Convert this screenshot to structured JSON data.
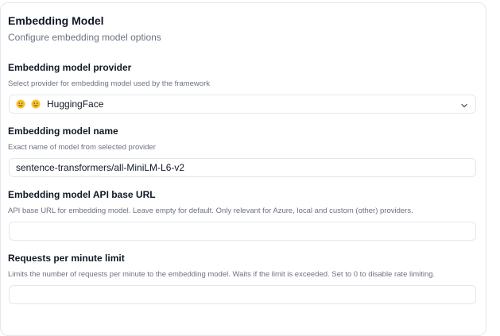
{
  "panel": {
    "title": "Embedding Model",
    "subtitle": "Configure embedding model options"
  },
  "fields": {
    "provider": {
      "label": "Embedding model provider",
      "description": "Select provider for embedding model used by the framework",
      "value": "HuggingFace",
      "icons": [
        "hugging-face-emoji-icon",
        "hugging-face-emoji-icon",
        "chevron-down-icon"
      ]
    },
    "model_name": {
      "label": "Embedding model name",
      "description": "Exact name of model from selected provider",
      "value": "sentence-transformers/all-MiniLM-L6-v2"
    },
    "api_base": {
      "label": "Embedding model API base URL",
      "description": "API base URL for embedding model. Leave empty for default. Only relevant for Azure, local and custom (other) providers.",
      "value": ""
    },
    "rate_limit": {
      "label": "Requests per minute limit",
      "description": "Limits the number of requests per minute to the embedding model. Waits if the limit is exceeded. Set to 0 to disable rate limiting.",
      "value": ""
    }
  },
  "colors": {
    "emoji": "#fbbf24",
    "border": "#e5e7eb",
    "muted_text": "#6b7280"
  }
}
